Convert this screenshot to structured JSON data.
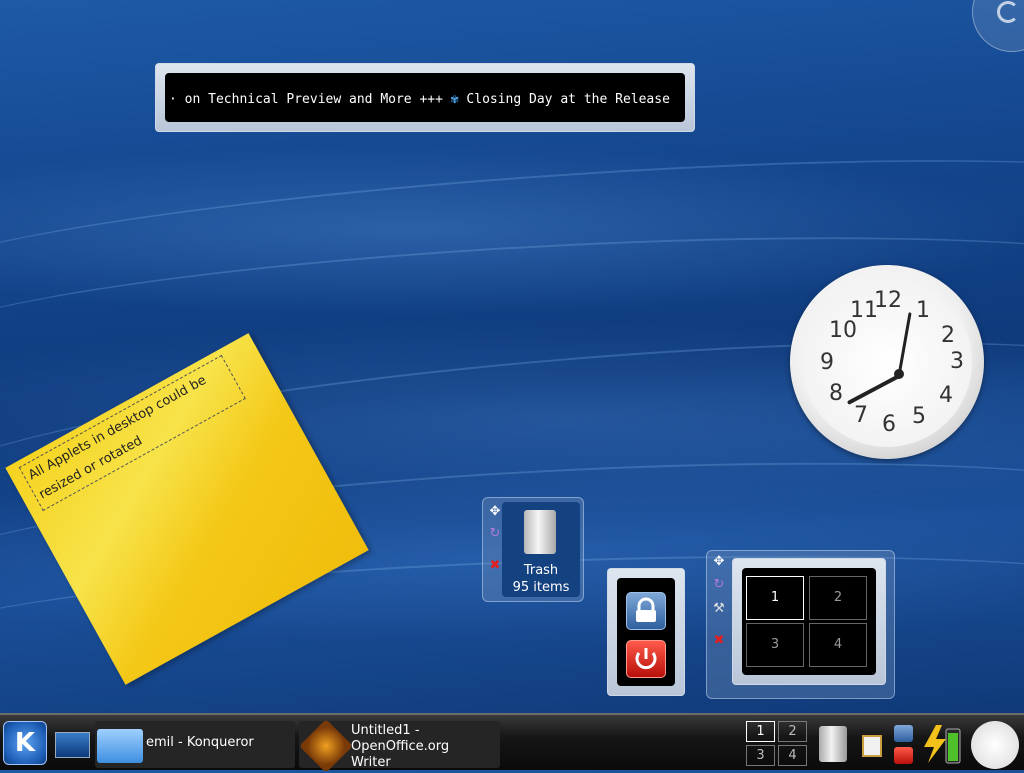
{
  "ticker": {
    "text_before_icon": "· on Technical Preview and More +++ ",
    "text_after_icon": " Closing Day at the Release",
    "icon": "gear-icon"
  },
  "note": {
    "text": "All Applets in desktop could be resized or rotated"
  },
  "clock": {
    "numbers": [
      "12",
      "1",
      "2",
      "3",
      "4",
      "5",
      "6",
      "7",
      "8",
      "9",
      "10",
      "11"
    ],
    "time_shown": "7:41"
  },
  "trash": {
    "label": "Trash",
    "count": "95 items"
  },
  "pager": {
    "desktops": [
      "1",
      "2",
      "3",
      "4"
    ],
    "active": "1"
  },
  "taskbar": {
    "tasks": [
      {
        "label": "emil - Konqueror",
        "icon": "folder-icon"
      },
      {
        "label": "Untitled1 - OpenOffice.org Writer",
        "icon": "openoffice-icon"
      }
    ],
    "pager_desktops": [
      "1",
      "2",
      "3",
      "4"
    ],
    "active_desktop": "1"
  },
  "colors": {
    "desktop": "#0f3a7c",
    "note": "#f4c817",
    "ticker_bg": "#000000"
  }
}
